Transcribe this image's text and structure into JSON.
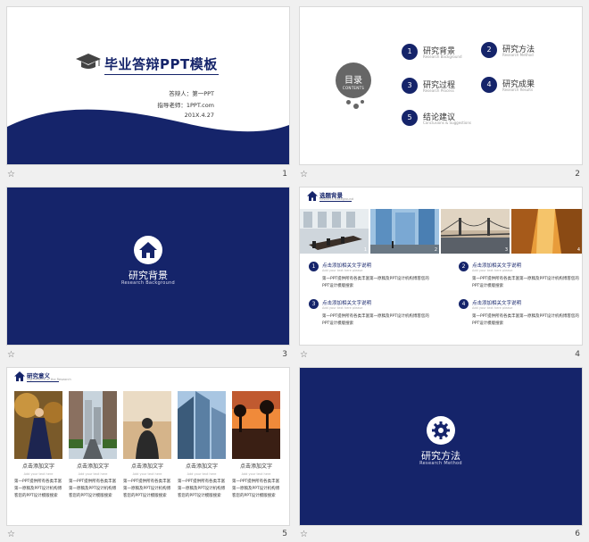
{
  "slides": [
    {
      "title": "毕业答辩PPT模板",
      "defender": "答辩人：第一PPT",
      "advisor": "指导老师：1PPT.com",
      "date": "201X.4.27",
      "number": "1"
    },
    {
      "toc_title": "目录",
      "toc_en": "CONTENTS",
      "items": [
        {
          "num": "1",
          "label": "研究背景",
          "en": "Research Background"
        },
        {
          "num": "2",
          "label": "研究方法",
          "en": "Research Method"
        },
        {
          "num": "3",
          "label": "研究过程",
          "en": "Research Process"
        },
        {
          "num": "4",
          "label": "研究成果",
          "en": "Research Results"
        },
        {
          "num": "5",
          "label": "结论建议",
          "en": "Conclusions & Suggestions"
        }
      ],
      "number": "2"
    },
    {
      "title": "研究背景",
      "en": "Research Background",
      "number": "3"
    },
    {
      "header": "选题背景",
      "header_en": "Research Background",
      "photos": [
        "1",
        "2",
        "3",
        "4"
      ],
      "cards": [
        {
          "num": "1",
          "title": "点击添加相关文字说明",
          "en": "Add your text here please",
          "body": "第一PPT提供所有各类丰富第一原稿及PPT设计机构博客您的PPT设计模版搜索"
        },
        {
          "num": "2",
          "title": "点击添加相关文字说明",
          "en": "Add your text here please",
          "body": "第一PPT提供所有各类丰富第一原稿及PPT设计机构博客您的PPT设计模版搜索"
        },
        {
          "num": "3",
          "title": "点击添加相关文字说明",
          "en": "Add your text here please",
          "body": "第一PPT提供所有各类丰富第一原稿及PPT设计机构博客您的PPT设计模版搜索"
        },
        {
          "num": "4",
          "title": "点击添加相关文字说明",
          "en": "Add your text here please",
          "body": "第一PPT提供所有各类丰富第一原稿及PPT设计机构博客您的PPT设计模版搜索"
        }
      ],
      "number": "4"
    },
    {
      "header": "研究意义",
      "header_en": "Significance of the Research",
      "cols": [
        {
          "title": "点击添加文字",
          "en": "Add your text here",
          "body": "第一PPT提供所有各类丰富第一原稿及PPT设计机构博客您的PPT设计模版搜索"
        },
        {
          "title": "点击添加文字",
          "en": "Add your text here",
          "body": "第一PPT提供所有各类丰富第一原稿及PPT设计机构博客您的PPT设计模版搜索"
        },
        {
          "title": "点击添加文字",
          "en": "Add your text here",
          "body": "第一PPT提供所有各类丰富第一原稿及PPT设计机构博客您的PPT设计模版搜索"
        },
        {
          "title": "点击添加文字",
          "en": "Add your text here",
          "body": "第一PPT提供所有各类丰富第一原稿及PPT设计机构博客您的PPT设计模版搜索"
        },
        {
          "title": "点击添加文字",
          "en": "Add your text here",
          "body": "第一PPT提供所有各类丰富第一原稿及PPT设计机构博客您的PPT设计模版搜索"
        }
      ],
      "number": "5"
    },
    {
      "title": "研究方法",
      "en": "Research Method",
      "number": "6"
    }
  ],
  "icons": {
    "star": "☆",
    "home": "home-icon",
    "gear": "gear-icon",
    "cap": "graduation-cap-icon"
  },
  "colors": {
    "navy": "#15246a",
    "gray": "#666666"
  }
}
